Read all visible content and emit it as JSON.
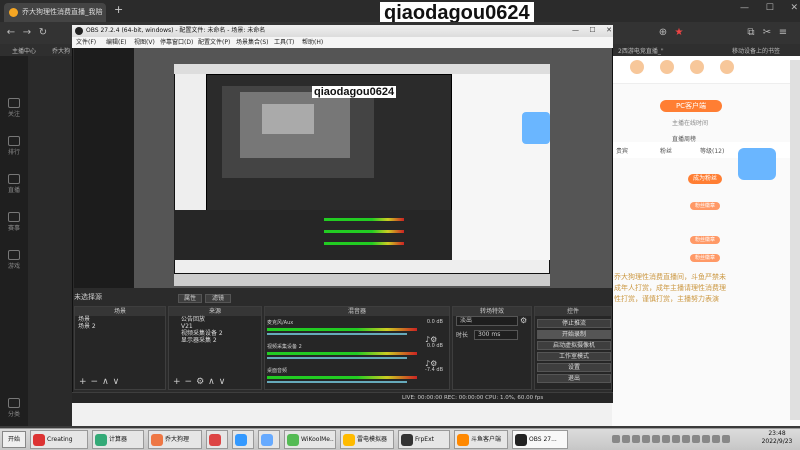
{
  "browser": {
    "tab_title": "乔大狗理性消费直播_我陪卡丁",
    "new_tab": "+",
    "watermark": "qiaodagou0624",
    "window_controls": [
      "—",
      "☐",
      "✕"
    ],
    "bookmarks": [
      "主播中心",
      "乔大狗",
      "2西游电竞直播_\"",
      "移动设备上的书签"
    ]
  },
  "left_nav": {
    "items": [
      "关注",
      "排行",
      "直播",
      "赛事",
      "游戏",
      "分类"
    ]
  },
  "right_panel": {
    "header_icons": [
      "",
      "",
      "",
      ""
    ],
    "pc_client": "PC客户端",
    "pc_sub": "主播在线时间",
    "rank_tabs": [
      "贵宾",
      "粉丝",
      "直播周榜",
      "等级(12)"
    ],
    "fans_btn": "成为粉丝",
    "chat_badges": [
      "粉丝徽章",
      "粉丝徽章",
      "粉丝徽章"
    ],
    "description": "乔大狗理性消费直播间，斗鱼严禁未成年人打赏，成年主播请理性消费理性打赏，谨慎打赏，主播努力表演"
  },
  "obs": {
    "title": "OBS 27.2.4 (64-bit, windows) - 配置文件: 未命名 - 场景: 未命名",
    "window_controls": [
      "—",
      "☐",
      "✕"
    ],
    "menu": [
      "文件(F)",
      "编辑(E)",
      "视图(V)",
      "停靠窗口(D)",
      "配置文件(P)",
      "场景集合(S)",
      "工具(T)",
      "帮助(H)"
    ],
    "nested_watermark": "qiaodagou0624",
    "no_source_label": "未选择源",
    "properties_btn": "属性",
    "filters_btn": "滤镜",
    "scenes": {
      "title": "场景",
      "items": [
        "场景",
        "场景 2"
      ]
    },
    "sources": {
      "title": "来源",
      "items": [
        "公告回放",
        "V21",
        "视频采集设备 2",
        "显示器采集 2"
      ]
    },
    "mixer": {
      "title": "混音器",
      "channels": [
        {
          "name": "麦克风/Aux",
          "db": "0.0 dB"
        },
        {
          "name": "视频采集设备 2",
          "db": "0.0 dB"
        },
        {
          "name": "桌面音频",
          "db": "-7.4 dB"
        }
      ]
    },
    "transitions": {
      "title": "转场特效",
      "type": "淡出",
      "duration_label": "时长",
      "duration_value": "300 ms"
    },
    "controls": {
      "title": "控件",
      "buttons": [
        "停止推流",
        "开始录制",
        "启动虚拟摄像机",
        "工作室模式",
        "设置",
        "退出"
      ]
    },
    "status": "LIVE: 00:00:00   REC: 00:00:00   CPU: 1.0%, 60.00 fps"
  },
  "taskbar": {
    "start": "开始",
    "tasks": [
      {
        "label": "Creating",
        "color": "#d33"
      },
      {
        "label": "计算器",
        "color": "#3a7"
      },
      {
        "label": "乔大狗理",
        "color": "#e74"
      },
      {
        "label": "",
        "color": "#d44"
      },
      {
        "label": "",
        "color": "#39f"
      },
      {
        "label": "",
        "color": "#6af"
      },
      {
        "label": "WiKoolMe..",
        "color": "#5b5"
      },
      {
        "label": "雷电模拟器",
        "color": "#fb0"
      },
      {
        "label": "FrpExt",
        "color": "#333"
      },
      {
        "label": "斗鱼客户端",
        "color": "#f80"
      },
      {
        "label": "OBS 27...",
        "color": "#222"
      }
    ],
    "clock_time": "23:48",
    "clock_date": "2022/9/23"
  }
}
